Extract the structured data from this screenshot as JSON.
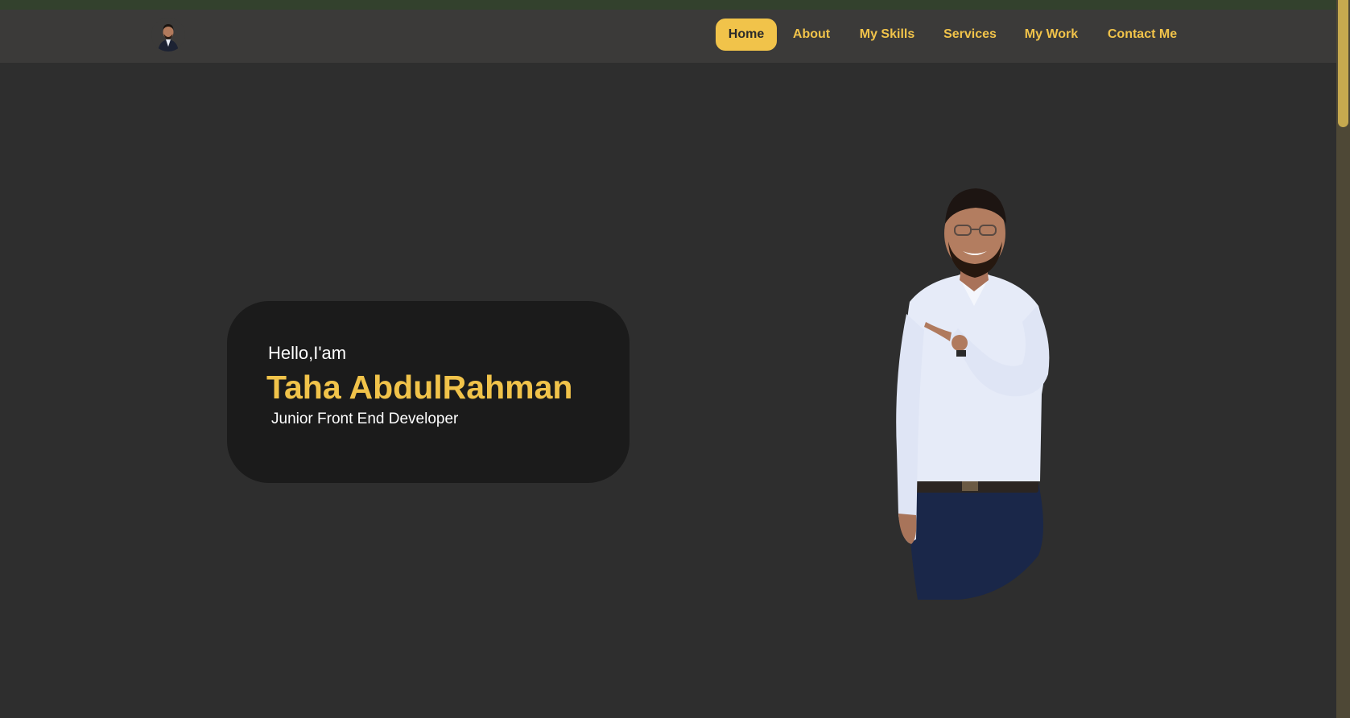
{
  "nav": {
    "items": [
      {
        "label": "Home",
        "active": true
      },
      {
        "label": "About",
        "active": false
      },
      {
        "label": "My Skills",
        "active": false
      },
      {
        "label": "Services",
        "active": false
      },
      {
        "label": "My Work",
        "active": false
      },
      {
        "label": "Contact Me",
        "active": false
      }
    ]
  },
  "hero": {
    "greeting": "Hello,I'am",
    "name": "Taha AbdulRahman",
    "role": "Junior Front End Developer"
  },
  "icons": {
    "logo": "profile-avatar",
    "portrait": "person-pointing-photo"
  },
  "colors": {
    "accent": "#f1c34a",
    "background": "#2e2e2e",
    "navbar": "#3b3a39",
    "card": "#1b1b1b",
    "top_strip": "#33412d"
  }
}
